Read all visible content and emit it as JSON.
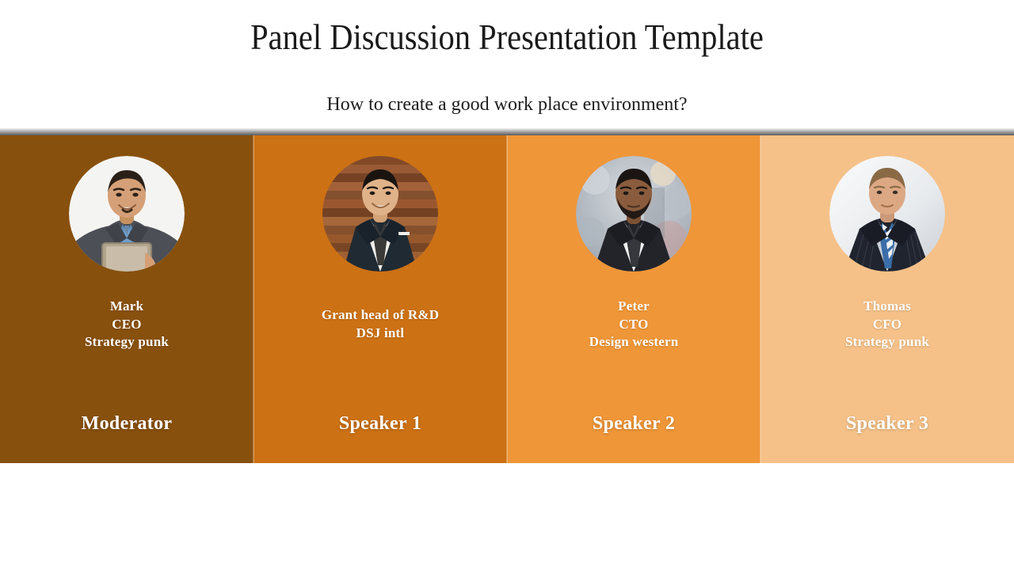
{
  "slide": {
    "title": "Panel Discussion Presentation Template",
    "subtitle": "How to create a good work place environment?",
    "background_color": "#ffffff"
  },
  "panels": [
    {
      "role_label": "Moderator",
      "color": "#88500d",
      "lines": [
        "Mark",
        "CEO",
        "Strategy punk"
      ],
      "avatar": {
        "name": "avatar-photo-mark",
        "description": "Smiling man in gray suit with blue striped tie holding a tablet on a white background",
        "background": "#f4f4f2",
        "suit": "#4c4f56",
        "shirt": "#8fb6d8",
        "tie": "#5d8fc0",
        "skin": "#d5a077",
        "hair": "#2b2018"
      }
    },
    {
      "role_label": "Speaker 1",
      "color": "#cc7114",
      "lines": [
        "Grant head of R&D",
        "DSJ intl"
      ],
      "avatar": {
        "name": "avatar-photo-grant",
        "description": "Smiling man in dark navy suit standing against a horizontal wooden plank wall",
        "background": "#9c5b33",
        "suit": "#1f2a33",
        "shirt": "#f2f0ec",
        "tie": "#3a3a38",
        "skin": "#e0b289",
        "hair": "#1a1411"
      }
    },
    {
      "role_label": "Speaker 2",
      "color": "#ef9638",
      "lines": [
        "Peter",
        "CTO",
        "Design western"
      ],
      "avatar": {
        "name": "avatar-photo-peter",
        "description": "Bearded man in black suit and dark tie with a blurred street crowd behind him",
        "background": "#b9bfc6",
        "suit": "#22242a",
        "shirt": "#f0f1f2",
        "tie": "#35373c",
        "skin": "#8a5c3d",
        "hair": "#1a1512"
      }
    },
    {
      "role_label": "Speaker 3",
      "color": "#f5c188",
      "lines": [
        "Thomas",
        "CFO",
        "Strategy punk"
      ],
      "avatar": {
        "name": "avatar-photo-thomas",
        "description": "Man in dark navy pinstripe suit with blue and white striped tie on a light gray studio background",
        "background": "#eceef0",
        "suit": "#20242e",
        "shirt": "#c9ced6",
        "tie": "#3b6ea8",
        "skin": "#dca884",
        "hair": "#8a6a45"
      }
    }
  ]
}
